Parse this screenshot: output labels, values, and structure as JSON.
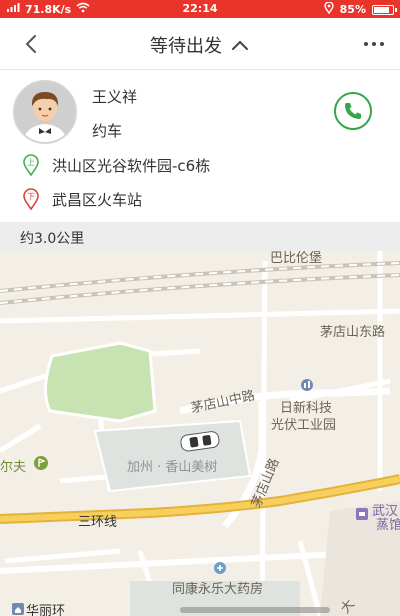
{
  "status_bar": {
    "network_speed": "71.8K/s",
    "time": "22:14",
    "battery": "85%",
    "battery_level": 0.85
  },
  "nav": {
    "title": "等待出发"
  },
  "driver": {
    "name": "王义祥",
    "car_type": "约车"
  },
  "route": {
    "start_marker": "上",
    "end_marker": "下",
    "start": "洪山区光谷软件园-c6栋",
    "end": "武昌区火车站"
  },
  "distance": "约3.0公里",
  "map": {
    "labels": {
      "top_partial": "巴比伦堡",
      "road_maodian_east": "茅店山东路",
      "road_maodian_middle": "茅店山中路",
      "rixin": "日新科技",
      "guangfu": "光伏工业园",
      "jiazhou": "加州 · 香山美树",
      "road_maodian_west": "茅店山路",
      "golf": "尔夫",
      "third_ring": "三环线",
      "wuhan": "武汉",
      "zhengguan": "蒸馆",
      "pharmacy": "同康永乐大药房",
      "huali": "华丽环",
      "corner": "大"
    }
  }
}
